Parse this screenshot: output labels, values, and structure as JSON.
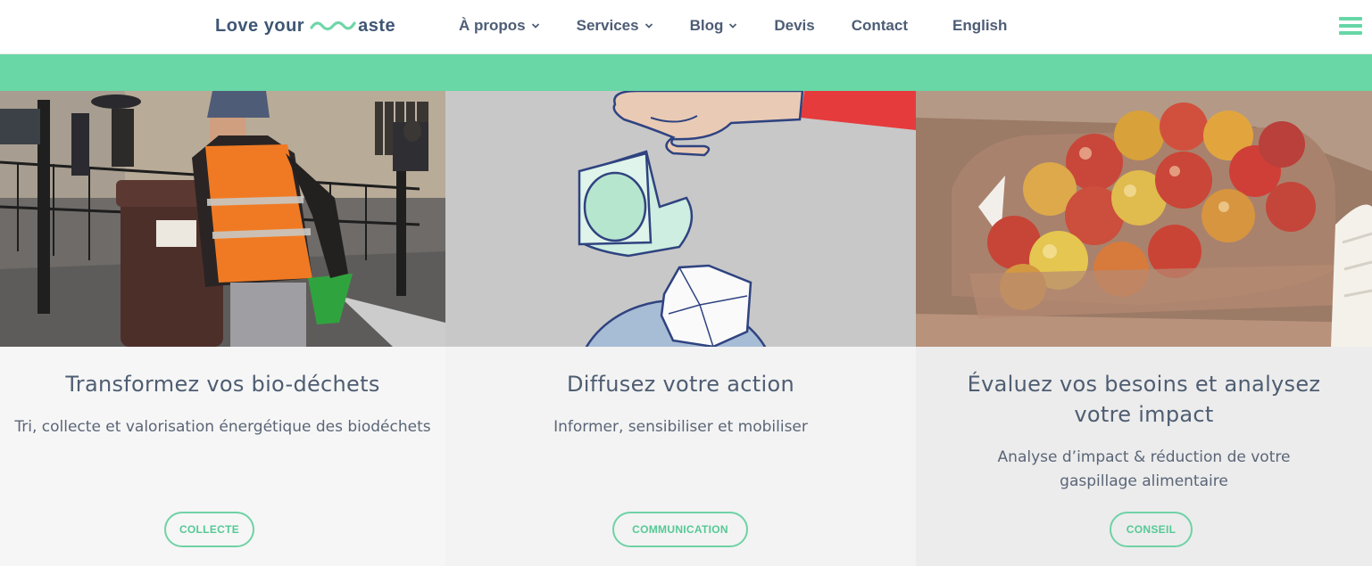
{
  "header": {
    "logo_left": "Love your",
    "logo_right": "aste",
    "menu": [
      {
        "label": "À propos",
        "dropdown": true
      },
      {
        "label": "Services",
        "dropdown": true
      },
      {
        "label": "Blog",
        "dropdown": true
      },
      {
        "label": "Devis",
        "dropdown": false
      },
      {
        "label": "Contact",
        "dropdown": false
      },
      {
        "label": "English",
        "dropdown": false
      }
    ]
  },
  "colors": {
    "accent": "#69d7a6",
    "text": "#4e5d72",
    "card_bg_1": "#f6f6f6",
    "card_bg_2": "#f3f3f3",
    "card_bg_3": "#ececec"
  },
  "cards": [
    {
      "title": "Transformez vos bio-déchets",
      "description": "Tri, collecte et valorisation énergétique des biodéchets",
      "button": "COLLECTE",
      "image": "photo of worker pushing a bio-waste bin"
    },
    {
      "title": "Diffusez votre action",
      "description": "Informer, sensibiliser et mobiliser",
      "button": "COMMUNICATION",
      "image": "illustration of hand dropping a yogurt cup and paper into a bin"
    },
    {
      "title": "Évaluez vos besoins et analysez votre impact",
      "description": "Analyse d’impact & réduction de votre gaspillage alimentaire",
      "button": "CONSEIL",
      "image": "photo of apples in a plastic crate"
    }
  ]
}
